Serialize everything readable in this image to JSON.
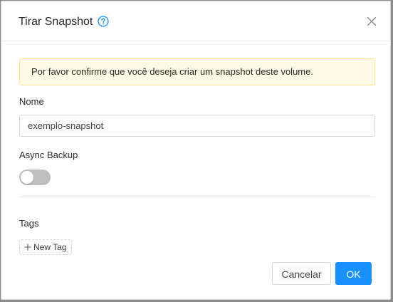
{
  "modal": {
    "title": "Tirar Snapshot",
    "help_icon": "question-circle-icon",
    "close_icon": "close-icon"
  },
  "alert": {
    "message": "Por favor confirme que você deseja criar um snapshot deste volume."
  },
  "form": {
    "name_label": "Nome",
    "name_value": "exemplo-snapshot",
    "async_label": "Async Backup",
    "async_enabled": false,
    "tags_label": "Tags",
    "new_tag_label": "New Tag"
  },
  "footer": {
    "cancel_label": "Cancelar",
    "ok_label": "OK"
  },
  "colors": {
    "primary": "#1890ff",
    "alert_bg": "#fffbe6",
    "alert_border": "#ffe58f",
    "toggle_off": "#bfbfbf"
  }
}
